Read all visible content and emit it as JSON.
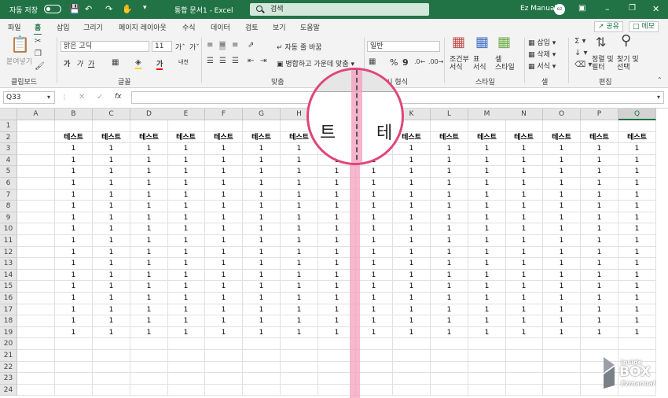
{
  "titlebar": {
    "autosave": "자동 저장",
    "toggle": "끔",
    "doc_title": "통합 문서1 - Excel",
    "search_placeholder": "검색",
    "user": "Ez Manual",
    "avatar": "ez"
  },
  "tabs": [
    "파일",
    "홈",
    "삽입",
    "그리기",
    "페이지 레이아웃",
    "수식",
    "데이터",
    "검토",
    "보기",
    "도움말"
  ],
  "active_tab": "홈",
  "share": "공유",
  "memo": "메모",
  "ribbon": {
    "clipboard": {
      "paste": "붙여넣기",
      "label": "클립보드"
    },
    "font": {
      "name": "맑은 고딕",
      "size": "11",
      "bold": "가",
      "italic": "가",
      "underline": "가",
      "grow": "가ˆ",
      "shrink": "가ˇ",
      "font_color": "가",
      "phonetic": "내천",
      "label": "글꼴"
    },
    "align": {
      "wrap": "자동 줄 바꿈",
      "merge": "병합하고 가운데 맞춤",
      "label": "맞춤"
    },
    "number": {
      "format": "일반",
      "percent": "%",
      "comma": "9",
      "label": "표시 형식"
    },
    "styles": {
      "cond": "조건부\n서식",
      "table": "표\n서식",
      "cell": "셀\n스타일",
      "label": "스타일"
    },
    "cells": {
      "insert": "삽입",
      "delete": "삭제",
      "format": "서식",
      "label": "셀"
    },
    "edit": {
      "sort": "정렬 및\n필터",
      "find": "찾기 및\n선택",
      "label": "편집"
    }
  },
  "namebox": "Q33",
  "fx": "fx",
  "columns": [
    "A",
    "B",
    "C",
    "D",
    "E",
    "F",
    "G",
    "H",
    "I",
    "J",
    "K",
    "L",
    "M",
    "N",
    "O",
    "P",
    "Q"
  ],
  "rows": [
    "1",
    "2",
    "3",
    "4",
    "5",
    "6",
    "7",
    "8",
    "9",
    "10",
    "11",
    "12",
    "13",
    "14",
    "15",
    "16",
    "17",
    "18",
    "19",
    "20",
    "21",
    "22",
    "23",
    "24"
  ],
  "header_text": "테스트",
  "cell_value": "1",
  "zoom": {
    "left": "트",
    "right": "테"
  },
  "watermark": {
    "line1": "inside",
    "line2": "BOX",
    "line3": "Ezmanual"
  }
}
